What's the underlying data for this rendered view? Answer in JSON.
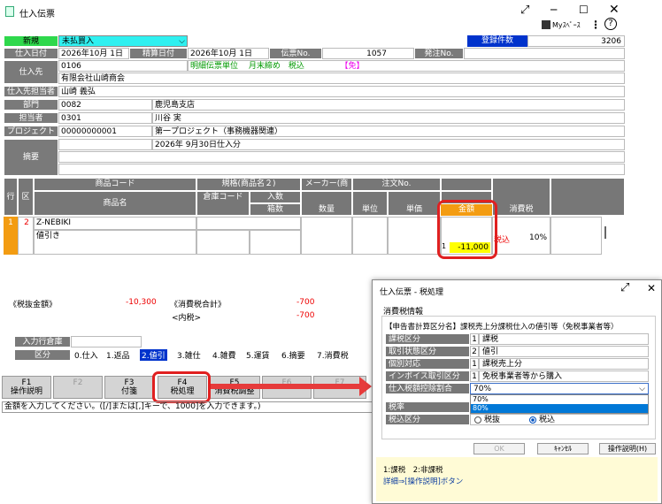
{
  "window": {
    "title": "仕入伝票",
    "myspace": "Myｽﾍﾟｰｽ"
  },
  "header": {
    "new_label": "新規",
    "pay_type": "未払買入",
    "record_count_label": "登録件数",
    "record_count": "3206",
    "purchase_date_label": "仕入日付",
    "purchase_date": "2026年10月 1日",
    "settle_date_label": "精算日付",
    "settle_date": "2026年10月 1日",
    "slip_no_label": "伝票No.",
    "slip_no": "1057",
    "order_no_label": "発注No.",
    "supplier_label": "仕入先",
    "supplier_code": "0106",
    "supplier_name": "有限会社山崎商会",
    "supplier_note1": "明細伝票単位",
    "supplier_note2": "月末締め",
    "supplier_note3": "税込",
    "supplier_note4": "【免】",
    "supplier_rep_label": "仕入先担当者",
    "supplier_rep": "山崎 義弘",
    "dept_label": "部門",
    "dept_code": "0082",
    "dept_name": "鹿児島支店",
    "staff_label": "担当者",
    "staff_code": "0301",
    "staff_name": "川谷 実",
    "project_label": "プロジェクト",
    "project_code": "00000000001",
    "project_name": "第一プロジェクト（事務機器関連）",
    "memo_label": "摘要",
    "memo_text": "2026年 9月30日仕入分"
  },
  "grid": {
    "col_row": "行",
    "col_kubun": "区",
    "col_code": "商品コード",
    "col_name": "商品名",
    "col_spec": "規格(商品名２)",
    "col_warehouse": "倉庫コード",
    "col_qty_in": "入数",
    "col_boxes": "箱数",
    "col_maker": "メーカー(商",
    "col_qty": "数量",
    "col_order": "注文No.",
    "col_unit": "単位",
    "col_price": "単価",
    "col_amount": "金額",
    "col_tax": "消費税",
    "row_no": "1",
    "row_kubun": "2",
    "row_code": "Z-NEBIKI",
    "row_name": "値引き",
    "row_amount_prefix": "1",
    "row_amount": "-11,000",
    "row_tax_type": "税込",
    "row_tax_rate": "10%"
  },
  "totals": {
    "pre_tax_label": "《税抜金額》",
    "pre_tax": "-10,300",
    "tax_total_label": "《消費税合計》",
    "tax_total": "-700",
    "incl_tax_label": "<内税>",
    "incl_tax": "-700"
  },
  "footer": {
    "warehouse_label": "入力行倉庫",
    "kubun_label": "区分",
    "kubun_items": [
      "0.仕入",
      "1.返品",
      "2.値引",
      "3.雑仕",
      "4.雑費",
      "5.運賃",
      "6.摘要",
      "7.消費税"
    ],
    "fkeys": [
      {
        "k": "F1",
        "t": "操作説明"
      },
      {
        "k": "F2",
        "t": ""
      },
      {
        "k": "F3",
        "t": "付箋"
      },
      {
        "k": "F4",
        "t": "税処理"
      },
      {
        "k": "F5",
        "t": "消費税調整"
      },
      {
        "k": "F6",
        "t": ""
      },
      {
        "k": "F7",
        "t": ""
      }
    ],
    "status": "金額を入力してください。([/]または[,]キーで、1000]を入力できます。)"
  },
  "dialog": {
    "title": "仕入伝票 - 税処理",
    "group": "消費税情報",
    "heading": "【申告書計算区分名】課税売上分課税仕入の値引等（免税事業者等）",
    "rows": [
      {
        "l": "課税区分",
        "n": "1",
        "v": "課税"
      },
      {
        "l": "取引状態区分",
        "n": "2",
        "v": "値引"
      },
      {
        "l": "個別対応",
        "n": "1",
        "v": "課税売上分"
      },
      {
        "l": "インボイス取引区分",
        "n": "1",
        "v": "免税事業者等から購入"
      }
    ],
    "deduct_label": "仕入税額控除割合",
    "deduct_value": "70%",
    "options": [
      "70%",
      "80%"
    ],
    "rate_label": "税率",
    "incl_label": "税込区分",
    "radio_excl": "税抜",
    "radio_incl": "税込",
    "ok": "OK",
    "cancel": "ｷｬﾝｾﾙ",
    "help": "操作説明(H)",
    "hint1": "1:課税　2:非課税",
    "hint2": "詳細⇒[操作説明]ボタン"
  }
}
